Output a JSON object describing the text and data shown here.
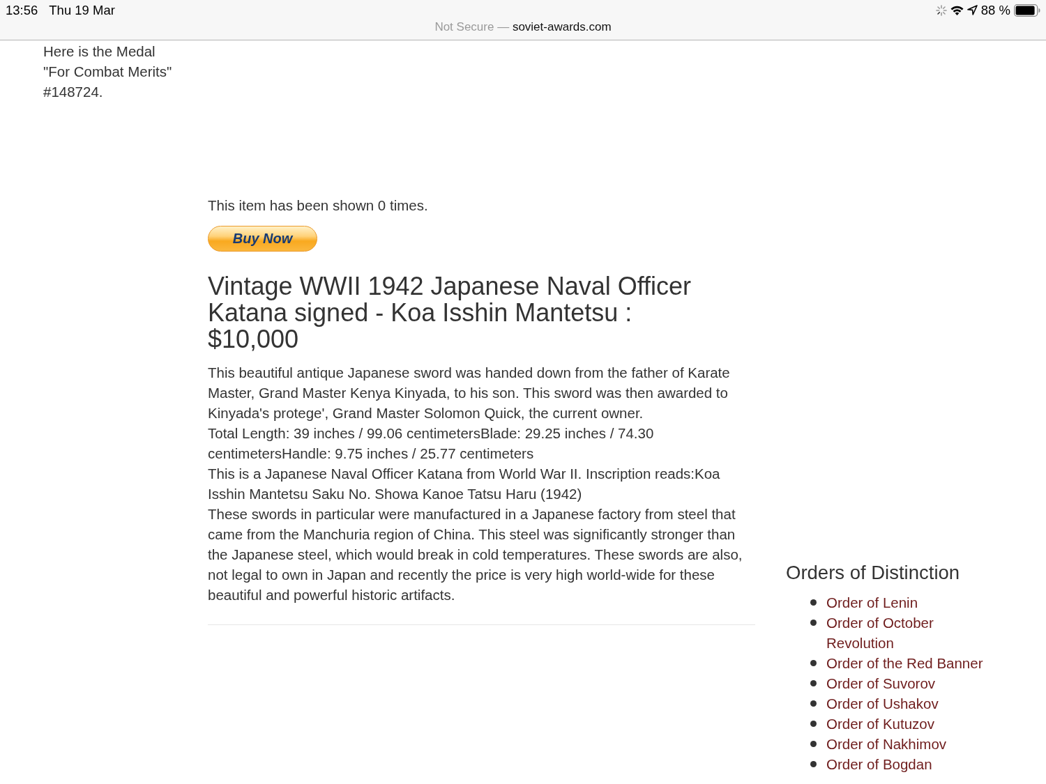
{
  "status_bar": {
    "time": "13:56",
    "date": "Thu 19 Mar",
    "battery_percent": "88 %"
  },
  "address_bar": {
    "security_label": "Not Secure —",
    "domain": "soviet-awards.com"
  },
  "left_column": {
    "caption_lines": [
      "Here is the Medal",
      "\"For Combat Merits\"",
      "#148724."
    ]
  },
  "main": {
    "view_count": "This item has been shown 0 times.",
    "buy_button": {
      "label": "Buy Now"
    },
    "title": "Vintage WWII 1942 Japanese Naval Officer Katana signed - Koa Isshin Mantetsu : $10,000",
    "paragraphs": [
      "This beautiful antique Japanese sword was handed down from the father of Karate Master, Grand Master Kenya Kinyada, to his son. This sword was then awarded to Kinyada's protege', Grand Master Solomon Quick, the current owner.",
      "Total Length: 39 inches / 99.06 centimetersBlade: 29.25 inches / 74.30 centimetersHandle: 9.75 inches / 25.77 centimeters",
      "This is a Japanese Naval Officer Katana from World War II. Inscription reads:Koa Isshin Mantetsu Saku No. Showa Kanoe Tatsu Haru (1942)",
      "These swords in particular were manufactured in a Japanese factory from steel that came from the Manchuria region of China. This steel was significantly stronger than the Japanese steel, which would break in cold temperatures. These swords are also, not legal to own in Japan and recently the price is very high world-wide for these beautiful and powerful historic artifacts."
    ]
  },
  "sidebar": {
    "heading": "Orders of Distinction",
    "links": [
      "Order of Lenin",
      "Order of October Revolution",
      "Order of the Red Banner",
      "Order of Suvorov",
      "Order of Ushakov",
      "Order of Kutuzov",
      "Order of Nakhimov",
      "Order of Bogdan"
    ]
  }
}
